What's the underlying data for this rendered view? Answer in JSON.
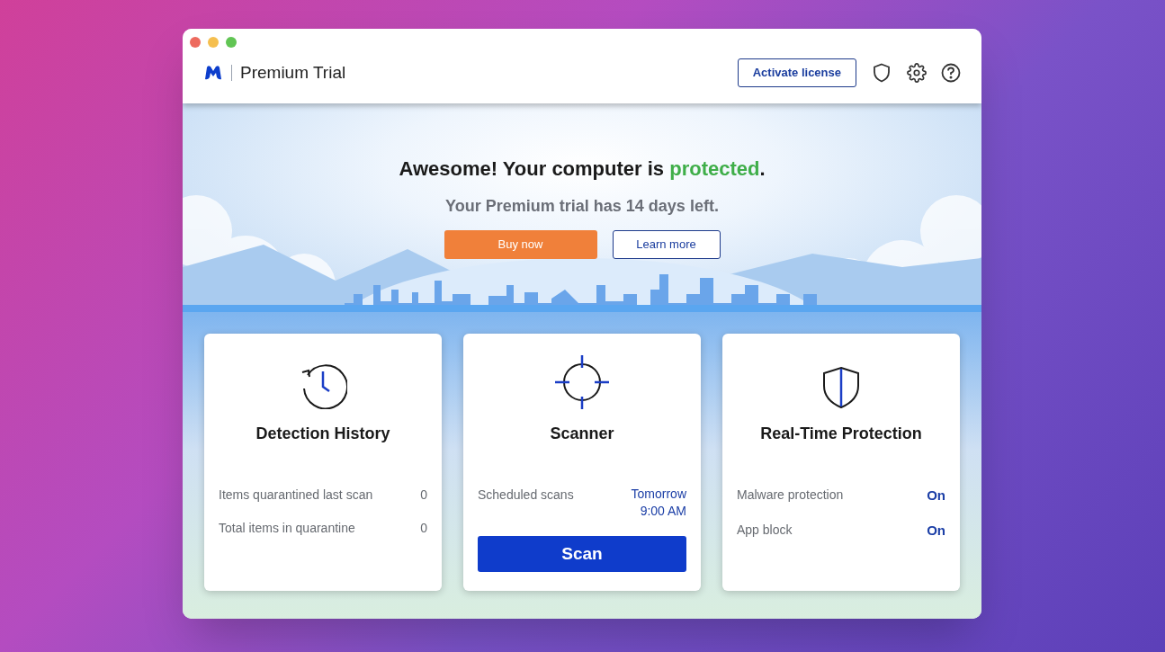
{
  "window": {
    "title": "Premium Trial"
  },
  "header": {
    "activate_button": "Activate license"
  },
  "hero": {
    "headline": {
      "text": "Awesome! Your computer is ",
      "highlight": "protected",
      "end": "."
    },
    "subtitle": "Your Premium trial has 14 days left.",
    "buttons": [
      {
        "label": "Buy now",
        "kind": "primary"
      },
      {
        "label": "Learn more",
        "kind": "secondary"
      }
    ]
  },
  "cards": [
    {
      "kind": "history",
      "title": "Detection History",
      "rows": [
        {
          "label": "Items quarantined last scan",
          "value": "0"
        },
        {
          "label": "Total items in quarantine",
          "value": "0"
        }
      ]
    },
    {
      "kind": "scanner",
      "title": "Scanner",
      "rows": [
        {
          "label": "Scheduled scans",
          "value": "Tomorrow 9:00 AM"
        }
      ],
      "button": "Scan"
    },
    {
      "kind": "protection",
      "title": "Real-Time Protection",
      "rows": [
        {
          "label": "Malware protection",
          "value": "On"
        },
        {
          "label": "App block",
          "value": "On"
        }
      ]
    }
  ]
}
